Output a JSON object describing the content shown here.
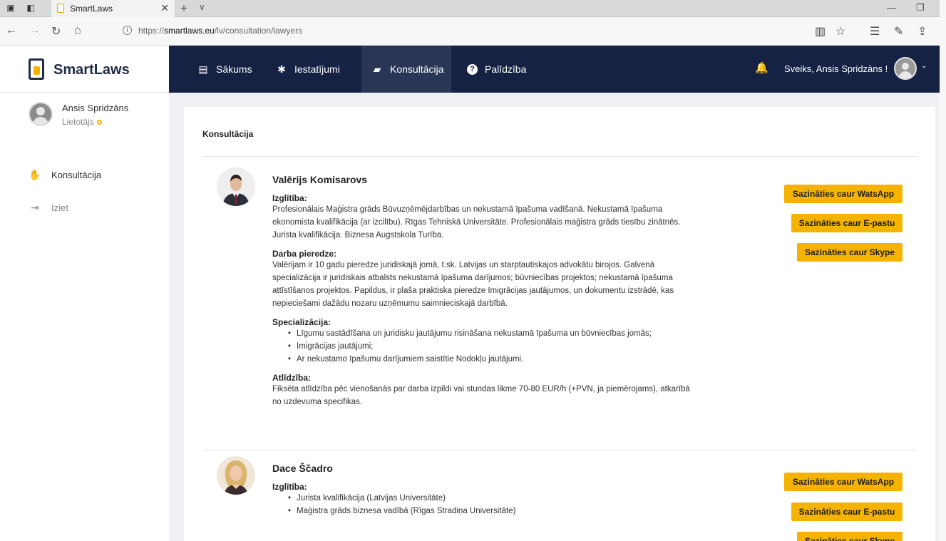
{
  "browser": {
    "tab_title": "SmartLaws",
    "url_scheme": "https://",
    "url_host": "smartlaws.eu",
    "url_path": "/lv/consultation/lawyers"
  },
  "brand": {
    "name": "SmartLaws"
  },
  "topnav": {
    "items": [
      {
        "label": "Sākums",
        "icon": "home-icon"
      },
      {
        "label": "Iestatījumi",
        "icon": "gear-icon"
      },
      {
        "label": "Konsultācija",
        "icon": "chat-icon",
        "active": true
      },
      {
        "label": "Palīdzība",
        "icon": "help-icon"
      }
    ],
    "greeting": "Sveiks, Ansis Spridzāns !"
  },
  "sidebar": {
    "user_name": "Ansis Spridzāns",
    "user_role": "Lietotājs",
    "items": [
      {
        "label": "Konsultācija",
        "icon": "hand-coin-icon"
      },
      {
        "label": "Iziet",
        "icon": "logout-icon"
      }
    ]
  },
  "main": {
    "title": "Konsultācija",
    "lawyers": [
      {
        "name": "Valērijs Komisarovs",
        "sections": [
          {
            "title": "Izglītība:",
            "text": "Profesionālais Maģistra grāds Būvuzņēmējdarbības un nekustamā īpašuma vadīšanā. Nekustamā īpašuma ekonomista kvalifikācija (ar izcilību). Rīgas Tehniskā Universitāte. Profesionālais maģistra grāds tiesību zinātnēs. Jurista kvalifikācija. Biznesa Augstskola Turība."
          },
          {
            "title": "Darba pieredze:",
            "text": "Valērijam ir 10 gadu pieredze juridiskajā jomā, t.sk. Latvijas un starptautiskajos advokātu birojos. Galvenā specializācija ir juridiskais atbalsts nekustamā īpašuma darījumos; būvniecības projektos; nekustamā īpašuma attīstīšanos projektos. Papildus, ir plaša praktiska pieredze Imigrācijas jautājumos, un dokumentu izstrādē, kas nepieciešami dažādu nozaru uzņēmumu saimnieciskajā darbībā."
          },
          {
            "title": "Specializācija:",
            "bullets": [
              "Līgumu sastādīšana un juridisku jautājumu risināšana nekustamā īpašuma un būvniecības jomās;",
              "Imigrācijas jautājumi;",
              "Ar nekustamo īpašumu darījumiem saistītie Nodokļu jautājumi."
            ]
          },
          {
            "title": "Atlīdzība:",
            "text": "Fiksēta atlīdzība pēc vienošanās par darba izpildi vai stundas likme 70-80 EUR/h (+PVN, ja piemērojams), atkarībā no uzdevuma specifikas."
          }
        ]
      },
      {
        "name": "Dace Ščadro",
        "sections": [
          {
            "title": "Izglītība:",
            "bullets": [
              "Jurista kvalifikācija (Latvijas Universitāte)",
              "Maģistra grāds biznesa vadībā (Rīgas Stradiņa Universitāte)"
            ]
          }
        ]
      }
    ],
    "buttons": {
      "whatsapp": "Sazināties caur WatsApp",
      "email": "Sazināties caur E-pastu",
      "skype": "Sazināties caur Skype"
    }
  },
  "colors": {
    "nav_bg": "#152243",
    "accent": "#f5b301",
    "brand_dark": "#1f2a44"
  }
}
